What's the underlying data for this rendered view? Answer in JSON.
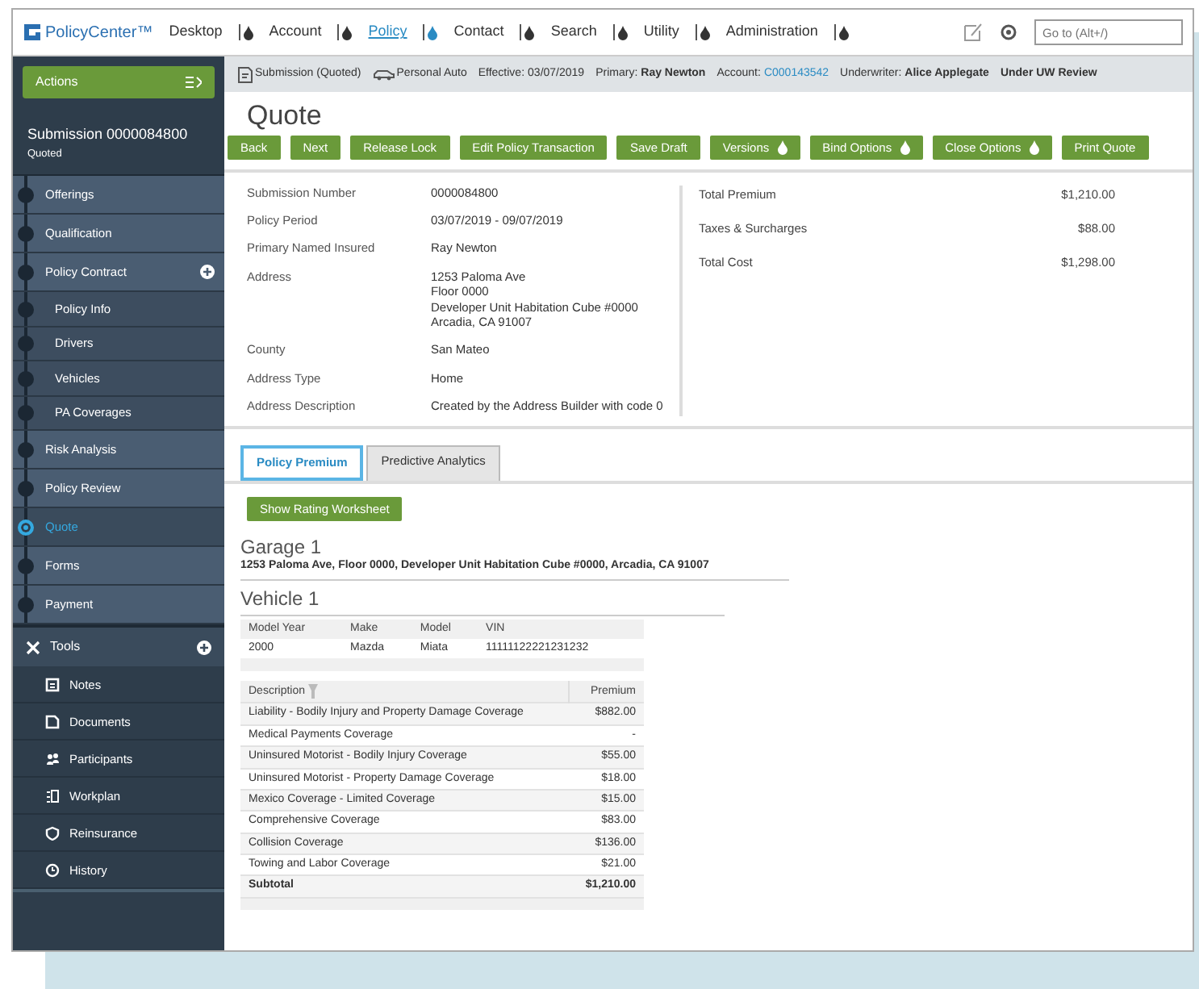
{
  "app": {
    "name": "PolicyCenter™",
    "goto_placeholder": "Go to (Alt+/)"
  },
  "nav": [
    {
      "label": "Desktop",
      "selected": false
    },
    {
      "label": "Account",
      "selected": false
    },
    {
      "label": "Policy",
      "selected": true
    },
    {
      "label": "Contact",
      "selected": false
    },
    {
      "label": "Search",
      "selected": false
    },
    {
      "label": "Utility",
      "selected": false
    },
    {
      "label": "Administration",
      "selected": false
    }
  ],
  "sidebar": {
    "actions": "Actions",
    "title": "Submission 0000084800",
    "subtitle": "Quoted",
    "steps": [
      {
        "label": "Offerings",
        "kind": "step",
        "selected": false
      },
      {
        "label": "Qualification",
        "kind": "step",
        "selected": false
      },
      {
        "label": "Policy Contract",
        "kind": "group",
        "selected": false
      },
      {
        "label": "Policy Info",
        "kind": "substep",
        "selected": false
      },
      {
        "label": "Drivers",
        "kind": "substep",
        "selected": false
      },
      {
        "label": "Vehicles",
        "kind": "substep",
        "selected": false
      },
      {
        "label": "PA Coverages",
        "kind": "substep",
        "selected": false
      },
      {
        "label": "Risk Analysis",
        "kind": "step",
        "selected": false
      },
      {
        "label": "Policy Review",
        "kind": "step",
        "selected": false
      },
      {
        "label": "Quote",
        "kind": "step",
        "selected": true
      },
      {
        "label": "Forms",
        "kind": "step",
        "selected": false
      },
      {
        "label": "Payment",
        "kind": "step",
        "selected": false
      }
    ],
    "tools_label": "Tools",
    "tools": [
      {
        "label": "Notes",
        "kind": "notes"
      },
      {
        "label": "Documents",
        "kind": "documents"
      },
      {
        "label": "Participants",
        "kind": "participants"
      },
      {
        "label": "Workplan",
        "kind": "workplan"
      },
      {
        "label": "Reinsurance",
        "kind": "reinsurance"
      },
      {
        "label": "History",
        "kind": "history"
      }
    ]
  },
  "info_bar": {
    "job": "Submission (Quoted)",
    "product": "Personal Auto",
    "effective_label": "Effective:",
    "effective": "03/07/2019",
    "primary_label": "Primary:",
    "primary": "Ray Newton",
    "account_label": "Account:",
    "account": "C000143542",
    "underwriter_label": "Underwriter:",
    "underwriter": "Alice Applegate",
    "status": "Under UW Review"
  },
  "page_title": "Quote",
  "buttons": [
    {
      "label": "Back",
      "menu": false
    },
    {
      "label": "Next",
      "menu": false
    },
    {
      "label": "Release Lock",
      "menu": false
    },
    {
      "label": "Edit Policy Transaction",
      "menu": false
    },
    {
      "label": "Save Draft",
      "menu": false
    },
    {
      "label": "Versions",
      "menu": true
    },
    {
      "label": "Bind Options",
      "menu": true
    },
    {
      "label": "Close Options",
      "menu": true
    },
    {
      "label": "Print Quote",
      "menu": false
    }
  ],
  "details": [
    {
      "label": "Submission Number",
      "value": "0000084800"
    },
    {
      "label": "Policy Period",
      "value": "03/07/2019 - 09/07/2019"
    },
    {
      "label": "Primary Named Insured",
      "value": "Ray Newton"
    },
    {
      "label": "Address",
      "value": "1253 Paloma Ave\nFloor 0000\nDeveloper Unit Habitation Cube #0000\nArcadia, CA 91007"
    },
    {
      "label": "County",
      "value": "San Mateo"
    },
    {
      "label": "Address Type",
      "value": "Home"
    },
    {
      "label": "Address Description",
      "value": "Created by the Address Builder with code 0"
    }
  ],
  "totals": [
    {
      "label": "Total Premium",
      "value": "$1,210.00"
    },
    {
      "label": "Taxes & Surcharges",
      "value": "$88.00"
    },
    {
      "label": "Total Cost",
      "value": "$1,298.00"
    }
  ],
  "tabs": [
    {
      "label": "Policy Premium",
      "selected": true
    },
    {
      "label": "Predictive Analytics",
      "selected": false
    }
  ],
  "worksheet_button": "Show Rating Worksheet",
  "garage": {
    "title": "Garage 1",
    "address": "1253 Paloma Ave, Floor 0000, Developer Unit Habitation Cube #0000, Arcadia, CA 91007"
  },
  "vehicle": {
    "title": "Vehicle 1",
    "columns": [
      "Model Year",
      "Make",
      "Model",
      "VIN"
    ],
    "rows": [
      [
        "2000",
        "Mazda",
        "Miata",
        "11111122221231232"
      ]
    ]
  },
  "coverages": {
    "columns": [
      "Description",
      "Premium"
    ],
    "rows": [
      {
        "description": "Liability - Bodily Injury and Property Damage Coverage",
        "premium": "$882.00",
        "kind": "row"
      },
      {
        "description": "Medical Payments Coverage",
        "premium": "-",
        "kind": "row"
      },
      {
        "description": "Uninsured Motorist - Bodily Injury Coverage",
        "premium": "$55.00",
        "kind": "row"
      },
      {
        "description": "Uninsured Motorist - Property Damage Coverage",
        "premium": "$18.00",
        "kind": "row"
      },
      {
        "description": "Mexico Coverage - Limited Coverage",
        "premium": "$15.00",
        "kind": "row"
      },
      {
        "description": "Comprehensive Coverage",
        "premium": "$83.00",
        "kind": "row"
      },
      {
        "description": "Collision Coverage",
        "premium": "$136.00",
        "kind": "row"
      },
      {
        "description": "Towing and Labor Coverage",
        "premium": "$21.00",
        "kind": "row"
      },
      {
        "description": "Subtotal",
        "premium": "$1,210.00",
        "kind": "subtotal"
      }
    ]
  }
}
